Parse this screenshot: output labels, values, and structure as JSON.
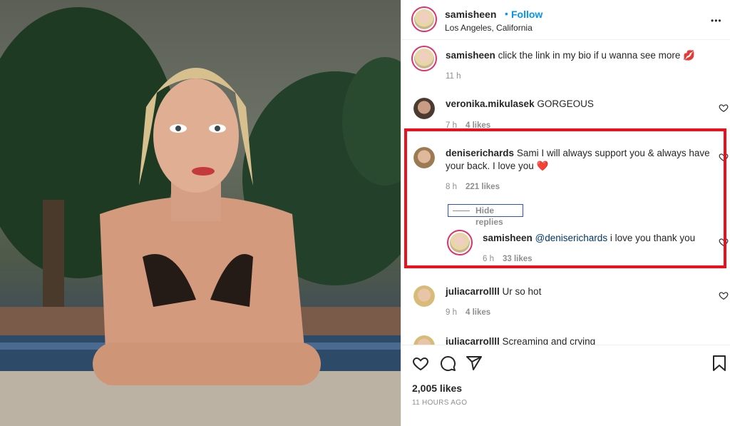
{
  "post": {
    "author": "samisheen",
    "follow_label": "Follow",
    "location": "Los Angeles, California",
    "caption": "click the link in my bio if u wanna see more 💋",
    "caption_time": "11 h",
    "likes": "2,005 likes",
    "posted_ago": "11 HOURS AGO",
    "more_label": "•••"
  },
  "comments": [
    {
      "user": "veronika.mikulasek",
      "text": "GORGEOUS",
      "time": "7 h",
      "likes": "4 likes"
    },
    {
      "user": "deniserichards",
      "text_line1": "Sami I will always support you & always have",
      "text_line2": "your back. I love you ❤️",
      "time": "8 h",
      "likes": "221 likes",
      "hide_replies": "Hide replies",
      "reply": {
        "user": "samisheen",
        "mention": "@deniserichards",
        "text": "i love you thank you",
        "time": "6 h",
        "likes": "33 likes"
      }
    },
    {
      "user": "juliacarrollll",
      "text": "Ur so hot",
      "time": "9 h",
      "likes": "4 likes"
    },
    {
      "user": "juliacarrollll",
      "text": "Screaming and crying"
    }
  ],
  "icons": [
    "heart-icon",
    "comment-icon",
    "share-icon",
    "bookmark-icon",
    "more-icon"
  ],
  "colors": {
    "follow": "#0095f6",
    "mention": "#00376b",
    "highlight": "#ee0f1d",
    "hide_border": "#2f4cdb"
  }
}
